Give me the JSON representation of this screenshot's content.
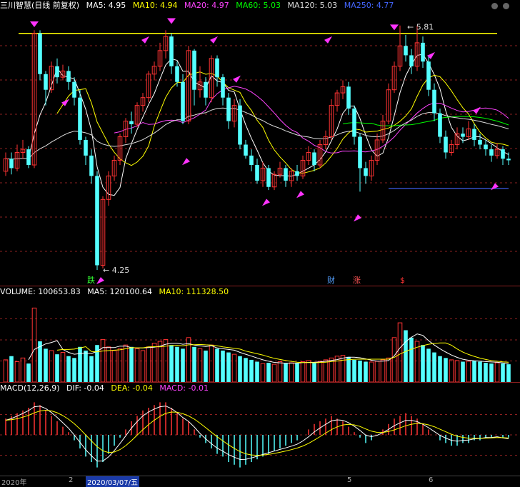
{
  "main_header": {
    "title": "三川智慧(日线 前复权)",
    "ma_items": [
      {
        "label": "MA5: 4.95",
        "color": "#ffffff"
      },
      {
        "label": "MA10: 4.94",
        "color": "#ffff00"
      },
      {
        "label": "MA20: 4.97",
        "color": "#ff44ff"
      },
      {
        "label": "MA60: 5.03",
        "color": "#00ff00"
      },
      {
        "label": "MA120: 5.03",
        "color": "#dddddd"
      },
      {
        "label": "MA250: 4.77",
        "color": "#4466ff"
      }
    ]
  },
  "volume_header": {
    "items": [
      {
        "label": "VOLUME: 100653.83",
        "color": "#ffffff"
      },
      {
        "label": "MA5: 120100.64",
        "color": "#ffffff"
      },
      {
        "label": "MA10: 111328.50",
        "color": "#ffff00"
      }
    ]
  },
  "macd_header": {
    "items": [
      {
        "label": "MACD(12,26,9)",
        "color": "#ffffff"
      },
      {
        "label": "DIF: -0.04",
        "color": "#ffffff"
      },
      {
        "label": "DEA: -0.04",
        "color": "#ffff00"
      },
      {
        "label": "MACD: -0.01",
        "color": "#ff44ff"
      }
    ]
  },
  "annotations": {
    "high_label": "5.81",
    "low_label": "4.25",
    "low_marker": "跌",
    "event_markers": [
      "财",
      "涨",
      "$"
    ]
  },
  "x_labels": [
    "2020年",
    "2",
    "2020/03/07/五",
    "5",
    "6"
  ],
  "colors": {
    "up": "#ff3333",
    "down": "#54ffff",
    "yellow_line": "#ffff00",
    "arrow": "#ff33ff",
    "grid": "#8a1f1f"
  },
  "chart_data": [
    {
      "type": "candlestick",
      "name_label": "三川智慧(日线 前复权)",
      "ylim": [
        4.15,
        5.9
      ],
      "horizontal_line": 5.76,
      "high_annotation": 5.81,
      "low_annotation": 4.25,
      "candles": [
        [
          4.88,
          4.96,
          5.0,
          4.85
        ],
        [
          4.96,
          4.9,
          5.0,
          4.86
        ],
        [
          4.9,
          5.0,
          5.05,
          4.88
        ],
        [
          5.0,
          5.02,
          5.08,
          4.96
        ],
        [
          5.02,
          4.92,
          5.04,
          4.9
        ],
        [
          4.92,
          5.76,
          5.78,
          4.9
        ],
        [
          5.76,
          5.5,
          5.78,
          5.46
        ],
        [
          5.5,
          5.4,
          5.52,
          5.3
        ],
        [
          5.4,
          5.55,
          5.58,
          5.38
        ],
        [
          5.55,
          5.48,
          5.6,
          5.44
        ],
        [
          5.48,
          5.52,
          5.56,
          5.46
        ],
        [
          5.52,
          5.45,
          5.55,
          5.4
        ],
        [
          5.45,
          5.35,
          5.48,
          5.3
        ],
        [
          5.35,
          5.08,
          5.4,
          5.05
        ],
        [
          5.08,
          4.98,
          5.1,
          4.92
        ],
        [
          4.98,
          4.85,
          5.02,
          4.8
        ],
        [
          4.85,
          4.28,
          4.88,
          4.25
        ],
        [
          4.28,
          4.7,
          4.72,
          4.26
        ],
        [
          4.7,
          4.85,
          4.88,
          4.66
        ],
        [
          4.85,
          4.95,
          4.98,
          4.82
        ],
        [
          4.95,
          5.1,
          5.12,
          4.92
        ],
        [
          5.1,
          5.2,
          5.22,
          5.06
        ],
        [
          5.2,
          5.18,
          5.26,
          5.12
        ],
        [
          5.18,
          5.3,
          5.32,
          5.16
        ],
        [
          5.3,
          5.35,
          5.38,
          5.26
        ],
        [
          5.35,
          5.5,
          5.52,
          5.32
        ],
        [
          5.5,
          5.55,
          5.58,
          5.46
        ],
        [
          5.55,
          5.65,
          5.7,
          5.52
        ],
        [
          5.65,
          5.74,
          5.78,
          5.6
        ],
        [
          5.74,
          5.55,
          5.76,
          5.5
        ],
        [
          5.55,
          5.45,
          5.58,
          5.42
        ],
        [
          5.45,
          5.2,
          5.5,
          5.18
        ],
        [
          5.2,
          5.65,
          5.68,
          5.18
        ],
        [
          5.65,
          5.4,
          5.66,
          5.3
        ],
        [
          5.4,
          5.45,
          5.55,
          5.35
        ],
        [
          5.45,
          5.35,
          5.48,
          5.3
        ],
        [
          5.35,
          5.6,
          5.62,
          5.32
        ],
        [
          5.6,
          5.48,
          5.62,
          5.42
        ],
        [
          5.48,
          5.35,
          5.5,
          5.3
        ],
        [
          5.35,
          5.2,
          5.38,
          5.15
        ],
        [
          5.2,
          5.3,
          5.34,
          5.16
        ],
        [
          5.3,
          5.05,
          5.34,
          5.02
        ],
        [
          5.05,
          4.98,
          5.08,
          4.96
        ],
        [
          4.98,
          4.92,
          5.02,
          4.88
        ],
        [
          4.92,
          4.82,
          4.96,
          4.8
        ],
        [
          4.82,
          4.9,
          4.94,
          4.78
        ],
        [
          4.9,
          4.78,
          4.92,
          4.76
        ],
        [
          4.78,
          4.86,
          4.88,
          4.76
        ],
        [
          4.86,
          4.9,
          4.94,
          4.84
        ],
        [
          4.9,
          4.82,
          4.92,
          4.78
        ],
        [
          4.82,
          4.88,
          4.9,
          4.78
        ],
        [
          4.88,
          4.85,
          4.92,
          4.82
        ],
        [
          4.85,
          4.95,
          4.98,
          4.83
        ],
        [
          4.95,
          5.0,
          5.04,
          4.92
        ],
        [
          5.0,
          4.92,
          5.02,
          4.88
        ],
        [
          4.92,
          5.05,
          5.08,
          4.9
        ],
        [
          5.05,
          5.1,
          5.14,
          5.02
        ],
        [
          5.1,
          5.3,
          5.34,
          5.08
        ],
        [
          5.3,
          5.38,
          5.4,
          5.26
        ],
        [
          5.38,
          5.42,
          5.46,
          5.34
        ],
        [
          5.42,
          5.28,
          5.45,
          5.24
        ],
        [
          5.28,
          5.1,
          5.3,
          5.05
        ],
        [
          5.1,
          4.9,
          5.12,
          4.75
        ],
        [
          4.9,
          4.85,
          4.94,
          4.8
        ],
        [
          4.85,
          4.95,
          4.98,
          4.82
        ],
        [
          4.95,
          5.08,
          5.12,
          4.92
        ],
        [
          5.08,
          5.2,
          5.24,
          5.06
        ],
        [
          5.2,
          5.4,
          5.44,
          5.18
        ],
        [
          5.4,
          5.55,
          5.58,
          5.38
        ],
        [
          5.55,
          5.68,
          5.81,
          5.52
        ],
        [
          5.68,
          5.62,
          5.75,
          5.58
        ],
        [
          5.62,
          5.55,
          5.66,
          5.5
        ],
        [
          5.55,
          5.7,
          5.81,
          5.52
        ],
        [
          5.7,
          5.58,
          5.74,
          5.54
        ],
        [
          5.58,
          5.4,
          5.62,
          5.36
        ],
        [
          5.4,
          5.25,
          5.44,
          5.2
        ],
        [
          5.25,
          5.1,
          5.28,
          5.06
        ],
        [
          5.1,
          5.0,
          5.14,
          4.96
        ],
        [
          5.0,
          5.05,
          5.08,
          4.98
        ],
        [
          5.05,
          5.12,
          5.16,
          5.02
        ],
        [
          5.12,
          5.1,
          5.16,
          5.06
        ],
        [
          5.1,
          5.15,
          5.2,
          5.08
        ],
        [
          5.15,
          5.08,
          5.18,
          5.04
        ],
        [
          5.08,
          5.05,
          5.12,
          5.02
        ],
        [
          5.05,
          5.02,
          5.08,
          4.98
        ],
        [
          5.02,
          4.98,
          5.05,
          4.94
        ],
        [
          4.98,
          5.02,
          5.06,
          4.96
        ],
        [
          5.02,
          4.96,
          5.04,
          4.92
        ],
        [
          4.96,
          4.95,
          5.0,
          4.92
        ]
      ]
    },
    {
      "type": "bar",
      "name_label": "VOLUME",
      "values": [
        60,
        70,
        55,
        65,
        50,
        200,
        110,
        90,
        85,
        75,
        80,
        70,
        65,
        95,
        85,
        70,
        100,
        115,
        95,
        85,
        90,
        100,
        95,
        90,
        85,
        95,
        105,
        110,
        115,
        100,
        95,
        90,
        120,
        95,
        90,
        85,
        100,
        90,
        85,
        80,
        75,
        70,
        65,
        60,
        55,
        50,
        52,
        48,
        55,
        50,
        52,
        50,
        55,
        58,
        52,
        56,
        60,
        65,
        70,
        72,
        68,
        60,
        58,
        55,
        54,
        56,
        60,
        65,
        120,
        160,
        140,
        120,
        110,
        100,
        90,
        80,
        70,
        65,
        60,
        58,
        55,
        56,
        58,
        55,
        52,
        50,
        52,
        50,
        48
      ],
      "ylim": [
        0,
        220
      ]
    },
    {
      "type": "bar",
      "name_label": "MACD(12,26,9)",
      "values": [
        0.06,
        0.07,
        0.08,
        0.09,
        0.1,
        0.12,
        0.11,
        0.09,
        0.07,
        0.05,
        0.03,
        0.01,
        -0.02,
        -0.05,
        -0.08,
        -0.1,
        -0.12,
        -0.1,
        -0.07,
        -0.04,
        -0.01,
        0.02,
        0.05,
        0.07,
        0.09,
        0.1,
        0.11,
        0.12,
        0.12,
        0.1,
        0.08,
        0.06,
        0.05,
        0.02,
        -0.01,
        -0.03,
        -0.05,
        -0.07,
        -0.08,
        -0.1,
        -0.11,
        -0.12,
        -0.11,
        -0.1,
        -0.09,
        -0.08,
        -0.07,
        -0.06,
        -0.05,
        -0.04,
        -0.03,
        -0.02,
        0.0,
        0.02,
        0.04,
        0.05,
        0.06,
        0.07,
        0.06,
        0.05,
        0.03,
        0.01,
        -0.01,
        -0.03,
        -0.02,
        0.0,
        0.02,
        0.04,
        0.06,
        0.07,
        0.08,
        0.07,
        0.06,
        0.04,
        0.02,
        0.0,
        -0.02,
        -0.03,
        -0.04,
        -0.04,
        -0.03,
        -0.03,
        -0.02,
        -0.02,
        -0.01,
        -0.01,
        0.0,
        -0.01,
        -0.01
      ],
      "ylim": [
        -0.15,
        0.15
      ]
    }
  ]
}
